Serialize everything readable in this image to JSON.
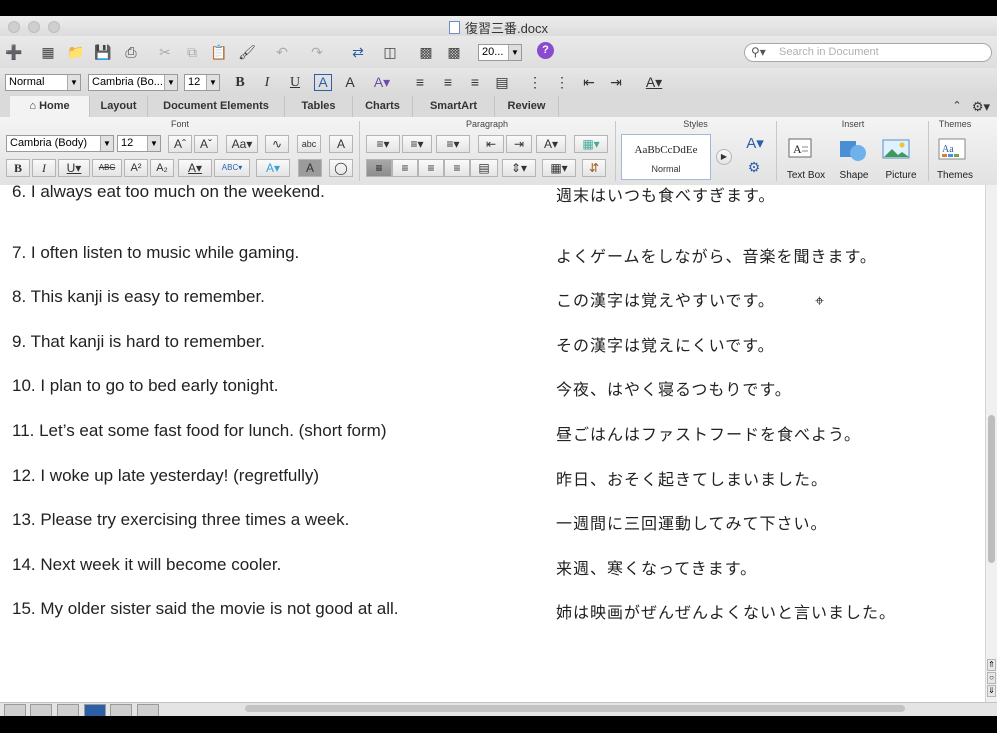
{
  "window": {
    "title": "復習三番.docx"
  },
  "toolbar": {
    "zoom_value": "20...",
    "search_placeholder": "Search in Document"
  },
  "format_bar": {
    "style_value": "Normal",
    "font_value": "Cambria (Bo...",
    "size_value": "12"
  },
  "tabs": [
    "Home",
    "Layout",
    "Document Elements",
    "Tables",
    "Charts",
    "SmartArt",
    "Review"
  ],
  "ribbon": {
    "groups": {
      "font": "Font",
      "paragraph": "Paragraph",
      "styles": "Styles",
      "insert": "Insert",
      "themes": "Themes"
    },
    "font_name": "Cambria (Body)",
    "font_size": "12",
    "style_preview": "AaBbCcDdEe",
    "style_name": "Normal",
    "insert_items": [
      "Text Box",
      "Shape",
      "Picture"
    ],
    "themes_label": "Themes"
  },
  "document": {
    "lines": [
      {
        "en": "6.  I always eat too much on the weekend.",
        "ja": "週末はいつも食べすぎます。"
      },
      {
        "en": "7.  I often listen to music while gaming.",
        "ja": "よくゲームをしながら、音楽を聞きます。"
      },
      {
        "en": "8.  This kanji is easy to remember.",
        "ja": "この漢字は覚えやすいです。"
      },
      {
        "en": "9.  That kanji is hard to remember.",
        "ja": "その漢字は覚えにくいです。"
      },
      {
        "en": "10.  I plan to go to bed early tonight.",
        "ja": "今夜、はやく寝るつもりです。"
      },
      {
        "en": "11.  Let’s eat some fast food for lunch. (short form)",
        "ja": "昼ごはんはファストフードを食べよう。"
      },
      {
        "en": "12.  I woke up late yesterday! (regretfully)",
        "ja": "昨日、おそく起きてしまいました。"
      },
      {
        "en": "13.  Please try exercising three times a week.",
        "ja": "一週間に三回運動してみて下さい。"
      },
      {
        "en": "14.  Next week it will become cooler.",
        "ja": "来週、寒くなってきます。"
      },
      {
        "en": "15.  My older sister said the movie is not good at all.",
        "ja": "姉は映画がぜんぜんよくないと言いました。"
      }
    ]
  }
}
